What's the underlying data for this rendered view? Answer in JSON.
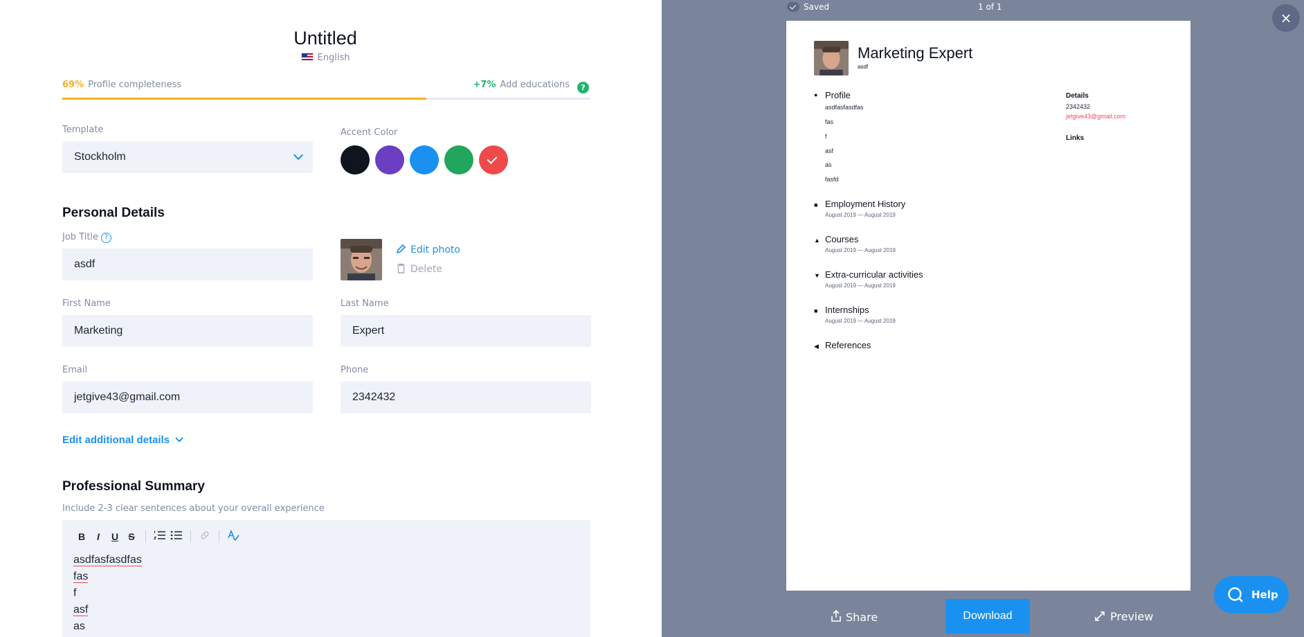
{
  "document": {
    "title": "Untitled",
    "language": "English"
  },
  "completeness": {
    "percent": "69%",
    "percent_value": 69,
    "label": "Profile completeness",
    "tip_percent": "+7%",
    "tip_label": "Add educations",
    "help": "?",
    "colors": {
      "progress": "#f7b01e",
      "tip": "#21b46f"
    }
  },
  "template": {
    "label": "Template",
    "value": "Stockholm"
  },
  "accent": {
    "label": "Accent Color",
    "swatches": [
      {
        "name": "black",
        "color": "#0f141e",
        "selected": false
      },
      {
        "name": "purple",
        "color": "#6c3ec3",
        "selected": false
      },
      {
        "name": "blue",
        "color": "#1a91f0",
        "selected": false
      },
      {
        "name": "green",
        "color": "#21a65c",
        "selected": false
      },
      {
        "name": "red",
        "color": "#ef4a4a",
        "selected": true
      }
    ]
  },
  "personal": {
    "heading": "Personal Details",
    "job_title": {
      "label": "Job Title",
      "value": "asdf"
    },
    "edit_photo": "Edit photo",
    "delete_photo": "Delete",
    "first_name": {
      "label": "First Name",
      "value": "Marketing"
    },
    "last_name": {
      "label": "Last Name",
      "value": "Expert"
    },
    "email": {
      "label": "Email",
      "value": "jetgive43@gmail.com"
    },
    "phone": {
      "label": "Phone",
      "value": "2342432"
    },
    "additional": "Edit additional details"
  },
  "summary": {
    "heading": "Professional Summary",
    "hint": "Include 2-3 clear sentences about your overall experience",
    "toolbar": {
      "bold": "B",
      "italic": "I",
      "underline": "U",
      "strike": "S"
    },
    "lines": [
      "asdfasfasdfas",
      "fas",
      "f",
      "asf",
      "as"
    ]
  },
  "preview": {
    "saved": "Saved",
    "pages": "1 of 1",
    "close": "×",
    "resume": {
      "name": "Marketing Expert",
      "job": "asdf",
      "sections": {
        "profile": "Profile",
        "employment": "Employment History",
        "courses": "Courses",
        "extra": "Extra-curricular activities",
        "internships": "Internships",
        "references": "References"
      },
      "profile_lines": [
        "asdfasfasdfas",
        "fas",
        "f",
        "asf",
        "as",
        "fasfd"
      ],
      "date_range": "August 2019  —  August 2019",
      "details_heading": "Details",
      "phone": "2342432",
      "email": "jetgive43@gmail.com",
      "links_heading": "Links"
    },
    "share": "Share",
    "download": "Download",
    "preview_btn": "Preview",
    "help": "Help"
  }
}
